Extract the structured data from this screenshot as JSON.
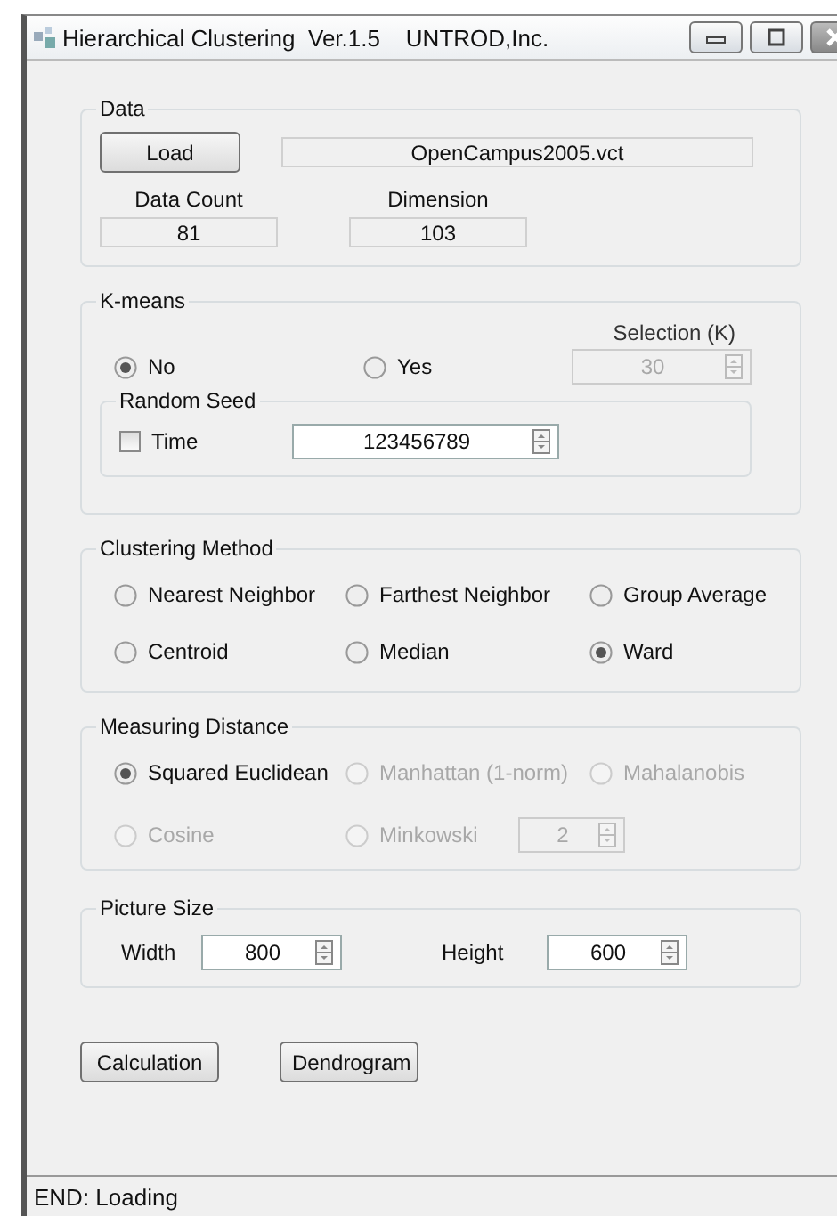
{
  "window": {
    "title": "Hierarchical Clustering  Ver.1.5    UNTROD,Inc."
  },
  "data": {
    "title": "Data",
    "load_button": "Load",
    "file_name": "OpenCampus2005.vct",
    "data_count": {
      "label": "Data Count",
      "value": "81"
    },
    "dimension": {
      "label": "Dimension",
      "value": "103"
    }
  },
  "kmeans": {
    "title": "K-means",
    "options": [
      {
        "label": "No",
        "selected": true
      },
      {
        "label": "Yes",
        "selected": false
      }
    ],
    "selection": {
      "label": "Selection (K)",
      "value": "30",
      "disabled": true
    },
    "random_seed": {
      "title": "Random Seed",
      "time": {
        "label": "Time",
        "checked": false
      },
      "value": "123456789"
    }
  },
  "clustering_method": {
    "title": "Clustering Method",
    "options": [
      {
        "label": "Nearest Neighbor",
        "selected": false
      },
      {
        "label": "Farthest Neighbor",
        "selected": false
      },
      {
        "label": "Group Average",
        "selected": false
      },
      {
        "label": "Centroid",
        "selected": false
      },
      {
        "label": "Median",
        "selected": false
      },
      {
        "label": "Ward",
        "selected": true
      }
    ]
  },
  "measuring_distance": {
    "title": "Measuring Distance",
    "options": [
      {
        "label": "Squared Euclidean",
        "selected": true,
        "disabled": false
      },
      {
        "label": "Manhattan (1-norm)",
        "selected": false,
        "disabled": true
      },
      {
        "label": "Mahalanobis",
        "selected": false,
        "disabled": true
      },
      {
        "label": "Cosine",
        "selected": false,
        "disabled": true
      },
      {
        "label": "Minkowski",
        "selected": false,
        "disabled": true
      }
    ],
    "minkowski_p": {
      "value": "2",
      "disabled": true
    }
  },
  "picture_size": {
    "title": "Picture Size",
    "width": {
      "label": "Width",
      "value": "800"
    },
    "height": {
      "label": "Height",
      "value": "600"
    }
  },
  "buttons": [
    "Calculation",
    "Dendrogram"
  ],
  "status_bar": "END: Loading"
}
